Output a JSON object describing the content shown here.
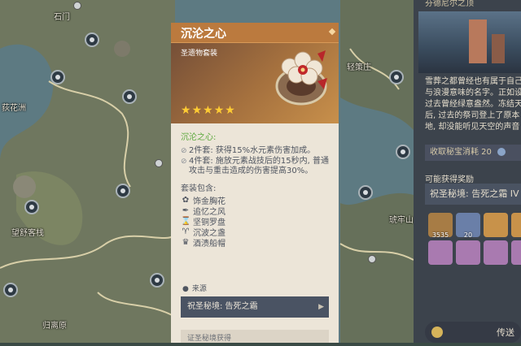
{
  "map": {
    "labels": [
      "石门",
      "荻花洲",
      "望舒客栈",
      "归离原",
      "轻策庄",
      "琥牢山"
    ],
    "colors": {
      "land": "#6f775f",
      "water": "#5d7a82",
      "road": "#d8cfa8"
    }
  },
  "card": {
    "title": "沉沦之心",
    "subtitle": "圣遗物套装",
    "rarity": 5,
    "stars": [
      "★",
      "★",
      "★",
      "★",
      "★"
    ],
    "set_name": "沉沦之心:",
    "bonuses": [
      {
        "mark": "⊘",
        "text": "2件套: 获得15%水元素伤害加成。"
      },
      {
        "mark": "⊘",
        "text": "4件套: 施放元素战技后的15秒内, 普通攻击与重击造成的伤害提高30%。"
      }
    ],
    "contains_title": "套装包含:",
    "pieces": [
      {
        "icon": "flower-icon",
        "glyph": "✿",
        "label": "饰金胸花"
      },
      {
        "icon": "feather-icon",
        "glyph": "✒",
        "label": "追忆之风"
      },
      {
        "icon": "hourglass-icon",
        "glyph": "⌛",
        "label": "坚铜罗盘"
      },
      {
        "icon": "goblet-icon",
        "glyph": "♈",
        "label": "沉波之盏"
      },
      {
        "icon": "crown-icon",
        "glyph": "♛",
        "label": "酒渍船帽"
      }
    ],
    "source_title": "来源",
    "source_domain": "祝圣秘境: 告死之霜",
    "source_next": "证圣秘境获得",
    "colors": {
      "title_bar": "#bb7a3e",
      "set_name": "#5aa83a",
      "star": "#ffcc33"
    }
  },
  "side_panel": {
    "title": "芬德尼尔之顶",
    "description": [
      "雪葬之都曾经也有属于自己",
      "与浪漫意味的名字。正如设",
      "过去曾经绿意盎然。冻结天",
      "后, 过去的祭司登上了原本",
      "地, 却没能听见天空的声音"
    ],
    "cost_label": "收取秘宝消耗 20",
    "rewards_title": "可能获得奖励",
    "domain_name": "祝圣秘境: 告死之霜 IV",
    "reward_counts": [
      "3535",
      "20"
    ],
    "teleport_label": "传送"
  }
}
